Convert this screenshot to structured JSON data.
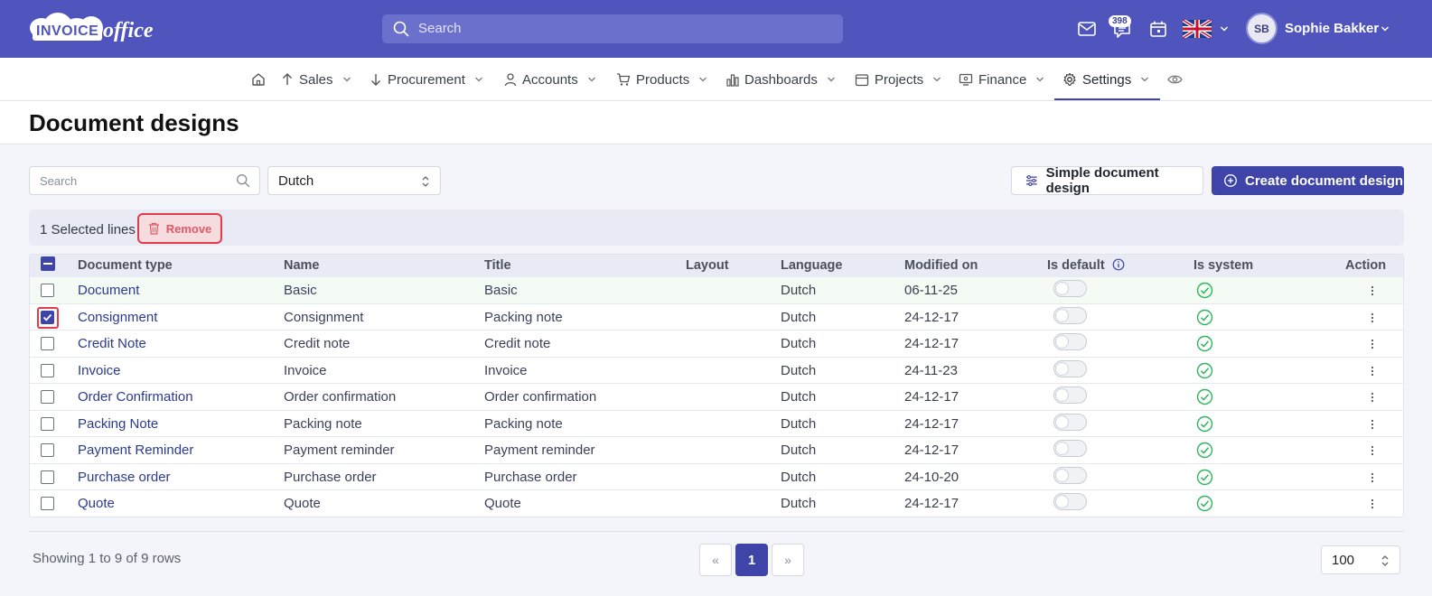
{
  "header": {
    "logo_text_a": "INVOICE",
    "logo_text_b": "office",
    "search_placeholder": "Search",
    "notification_count": "398",
    "user_initials": "SB",
    "user_name": "Sophie Bakker"
  },
  "nav": {
    "items": [
      {
        "label": "Sales"
      },
      {
        "label": "Procurement"
      },
      {
        "label": "Accounts"
      },
      {
        "label": "Products"
      },
      {
        "label": "Dashboards"
      },
      {
        "label": "Projects"
      },
      {
        "label": "Finance"
      },
      {
        "label": "Settings"
      }
    ],
    "active": "Settings"
  },
  "page": {
    "title": "Document designs"
  },
  "toolbar": {
    "search_placeholder": "Search",
    "language_selected": "Dutch",
    "simple_button": "Simple document design",
    "create_button": "Create document design"
  },
  "selection": {
    "text": "1 Selected lines",
    "remove_label": "Remove"
  },
  "table": {
    "columns": {
      "doc_type": "Document type",
      "name": "Name",
      "title": "Title",
      "layout": "Layout",
      "language": "Language",
      "modified": "Modified on",
      "is_default": "Is default",
      "is_system": "Is system",
      "action": "Action"
    },
    "rows": [
      {
        "doc_type": "Document",
        "name": "Basic",
        "title": "Basic",
        "layout": "",
        "language": "Dutch",
        "modified": "06-11-25",
        "is_default": false,
        "is_system": true,
        "selected": false
      },
      {
        "doc_type": "Consignment",
        "name": "Consignment",
        "title": "Packing note",
        "layout": "",
        "language": "Dutch",
        "modified": "24-12-17",
        "is_default": false,
        "is_system": true,
        "selected": true
      },
      {
        "doc_type": "Credit Note",
        "name": "Credit note",
        "title": "Credit note",
        "layout": "",
        "language": "Dutch",
        "modified": "24-12-17",
        "is_default": false,
        "is_system": true,
        "selected": false
      },
      {
        "doc_type": "Invoice",
        "name": "Invoice",
        "title": "Invoice",
        "layout": "",
        "language": "Dutch",
        "modified": "24-11-23",
        "is_default": false,
        "is_system": true,
        "selected": false
      },
      {
        "doc_type": "Order Confirmation",
        "name": "Order confirmation",
        "title": "Order confirmation",
        "layout": "",
        "language": "Dutch",
        "modified": "24-12-17",
        "is_default": false,
        "is_system": true,
        "selected": false
      },
      {
        "doc_type": "Packing Note",
        "name": "Packing note",
        "title": "Packing note",
        "layout": "",
        "language": "Dutch",
        "modified": "24-12-17",
        "is_default": false,
        "is_system": true,
        "selected": false
      },
      {
        "doc_type": "Payment Reminder",
        "name": "Payment reminder",
        "title": "Payment reminder",
        "layout": "",
        "language": "Dutch",
        "modified": "24-12-17",
        "is_default": false,
        "is_system": true,
        "selected": false
      },
      {
        "doc_type": "Purchase order",
        "name": "Purchase order",
        "title": "Purchase order",
        "layout": "",
        "language": "Dutch",
        "modified": "24-10-20",
        "is_default": false,
        "is_system": true,
        "selected": false
      },
      {
        "doc_type": "Quote",
        "name": "Quote",
        "title": "Quote",
        "layout": "",
        "language": "Dutch",
        "modified": "24-12-17",
        "is_default": false,
        "is_system": true,
        "selected": false
      }
    ]
  },
  "footer": {
    "showing_text": "Showing 1 to 9 of 9 rows",
    "prev_label": "«",
    "current_page": "1",
    "next_label": "»",
    "page_size": "100"
  },
  "colors": {
    "brand": "#4f55bd",
    "primary": "#3e44a8",
    "danger": "#e23b4a",
    "success": "#2bb55a"
  }
}
